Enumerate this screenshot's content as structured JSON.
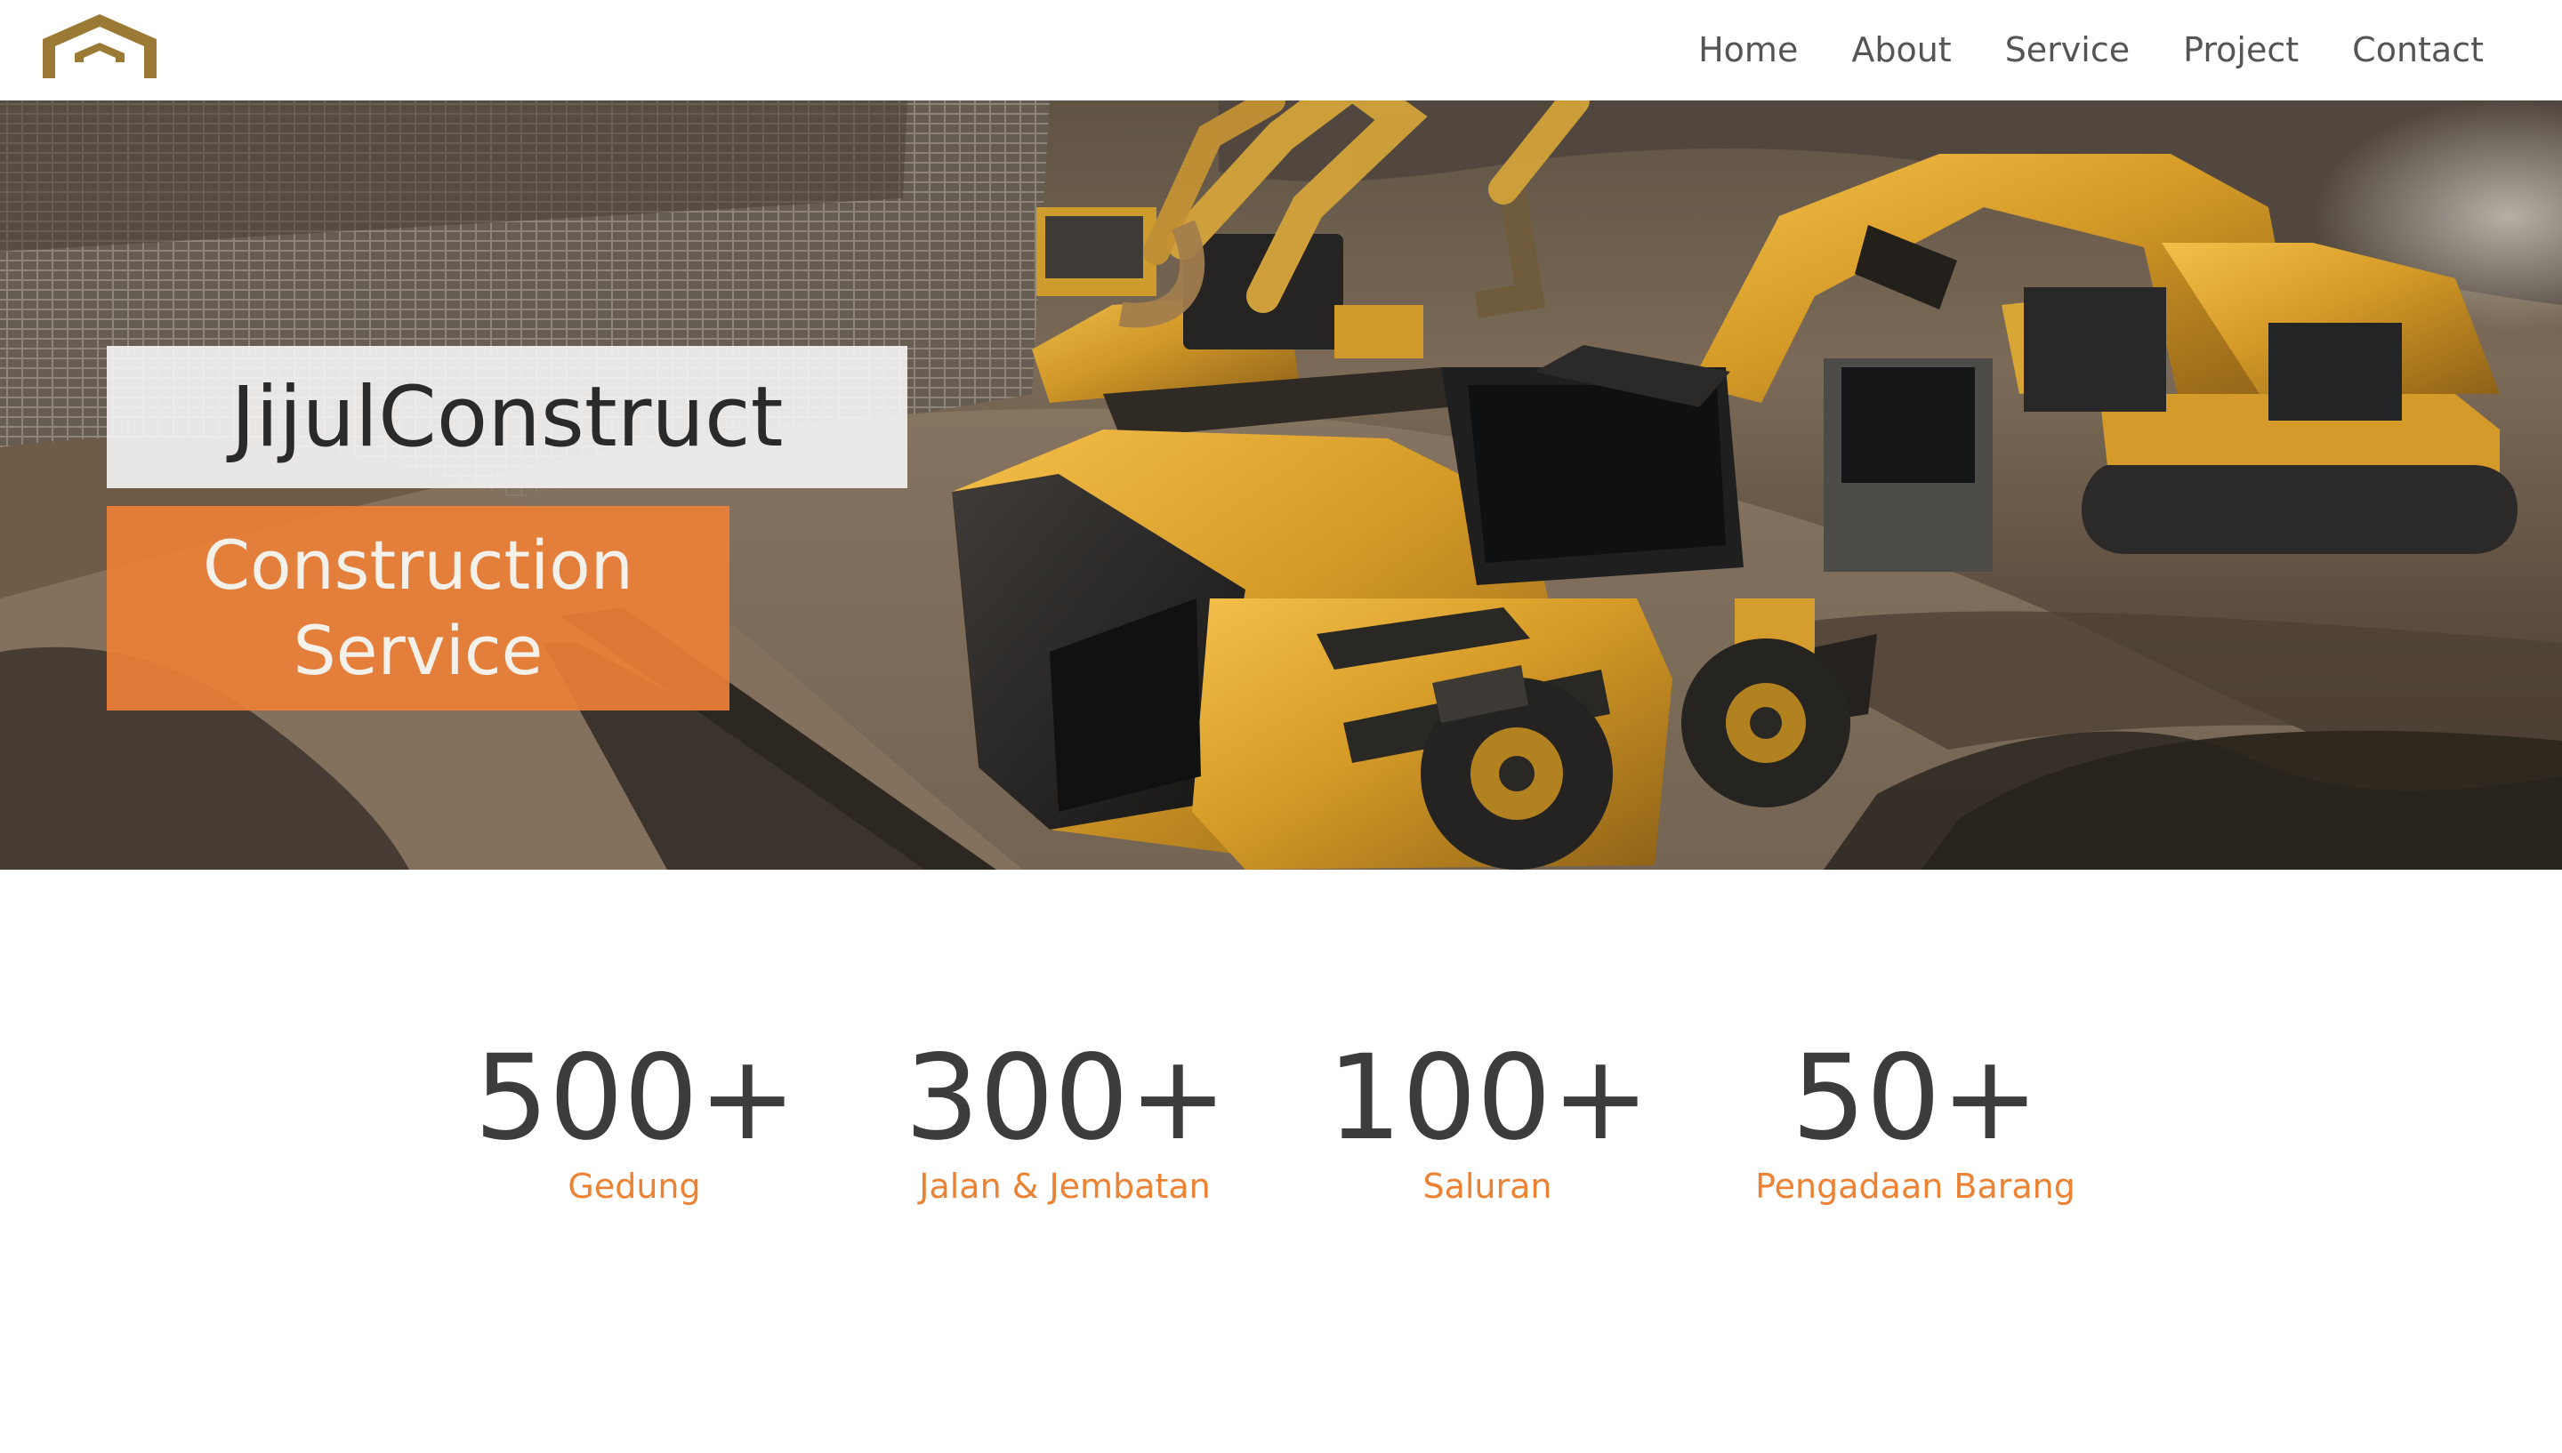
{
  "nav": {
    "items": [
      "Home",
      "About",
      "Service",
      "Project",
      "Contact"
    ]
  },
  "hero": {
    "title": "JijulConstruct",
    "subtitle": "Construction\nService"
  },
  "stats": [
    {
      "value": "500+",
      "label": "Gedung"
    },
    {
      "value": "300+",
      "label": "Jalan & Jembatan"
    },
    {
      "value": "100+",
      "label": "Saluran"
    },
    {
      "value": "50+",
      "label": "Pengadaan Barang"
    }
  ],
  "colors": {
    "accent": "#EC8233",
    "logo": "#9A7A35",
    "text_dark": "#3C3C3C",
    "nav_text": "#555555"
  }
}
